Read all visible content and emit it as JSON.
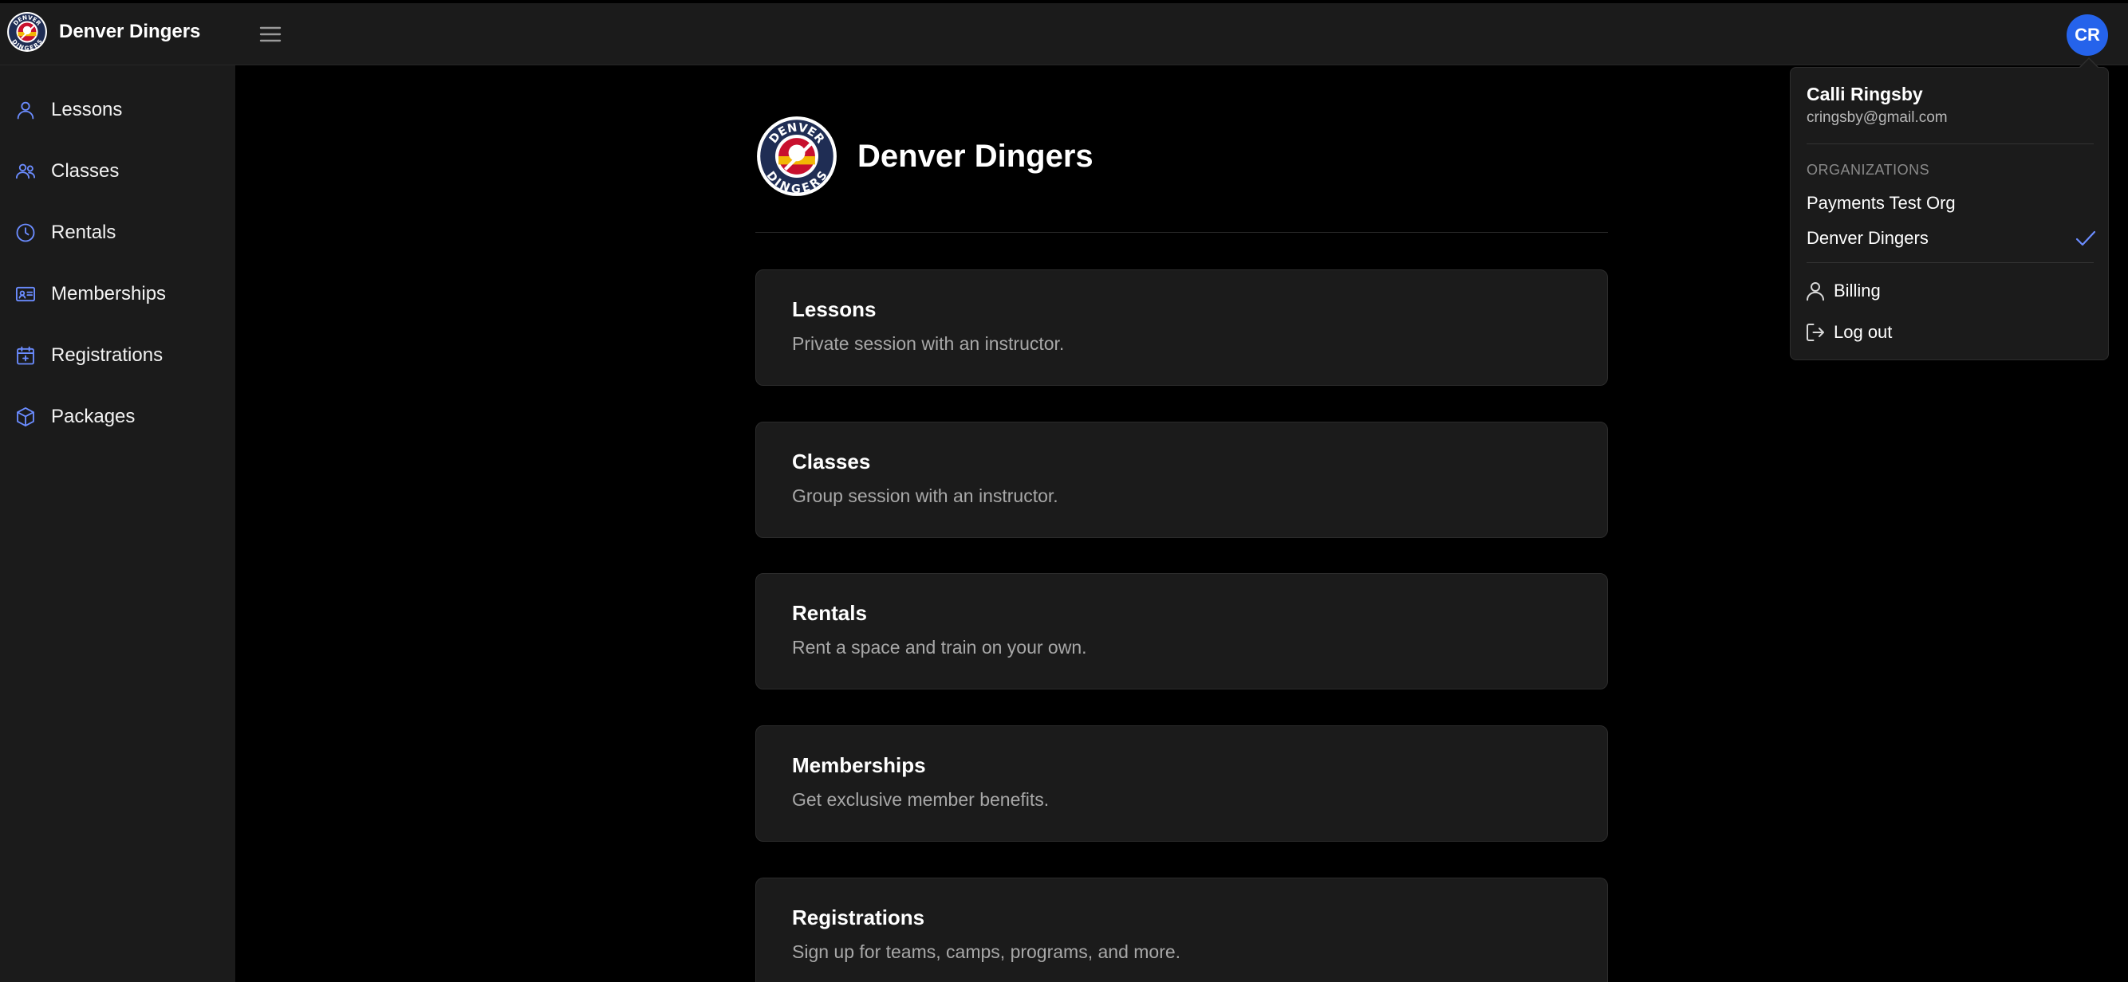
{
  "header": {
    "brand_name": "Denver Dingers",
    "avatar_initials": "CR"
  },
  "logo": {
    "top_text": "DENVER",
    "bottom_text": "DINGERS"
  },
  "sidebar": {
    "items": [
      {
        "label": "Lessons",
        "icon": "person-icon"
      },
      {
        "label": "Classes",
        "icon": "group-icon"
      },
      {
        "label": "Rentals",
        "icon": "clock-icon"
      },
      {
        "label": "Memberships",
        "icon": "id-card-icon"
      },
      {
        "label": "Registrations",
        "icon": "calendar-plus-icon"
      },
      {
        "label": "Packages",
        "icon": "box-icon"
      }
    ]
  },
  "main": {
    "org_title": "Denver Dingers",
    "cards": [
      {
        "title": "Lessons",
        "description": "Private session with an instructor."
      },
      {
        "title": "Classes",
        "description": "Group session with an instructor."
      },
      {
        "title": "Rentals",
        "description": "Rent a space and train on your own."
      },
      {
        "title": "Memberships",
        "description": "Get exclusive member benefits."
      },
      {
        "title": "Registrations",
        "description": "Sign up for teams, camps, programs, and more."
      }
    ]
  },
  "dropdown": {
    "user_name": "Calli Ringsby",
    "user_email": "cringsby@gmail.com",
    "organizations_label": "ORGANIZATIONS",
    "organizations": [
      {
        "name": "Payments Test Org",
        "selected": false
      },
      {
        "name": "Denver Dingers",
        "selected": true
      }
    ],
    "billing_label": "Billing",
    "logout_label": "Log out"
  },
  "colors": {
    "accent": "#2563eb",
    "icon_blue": "#6b8cff",
    "surface": "#1b1b1b",
    "background": "#000000",
    "logo_navy": "#1f2d54",
    "logo_red": "#c8102e",
    "logo_gold": "#f2b705"
  }
}
